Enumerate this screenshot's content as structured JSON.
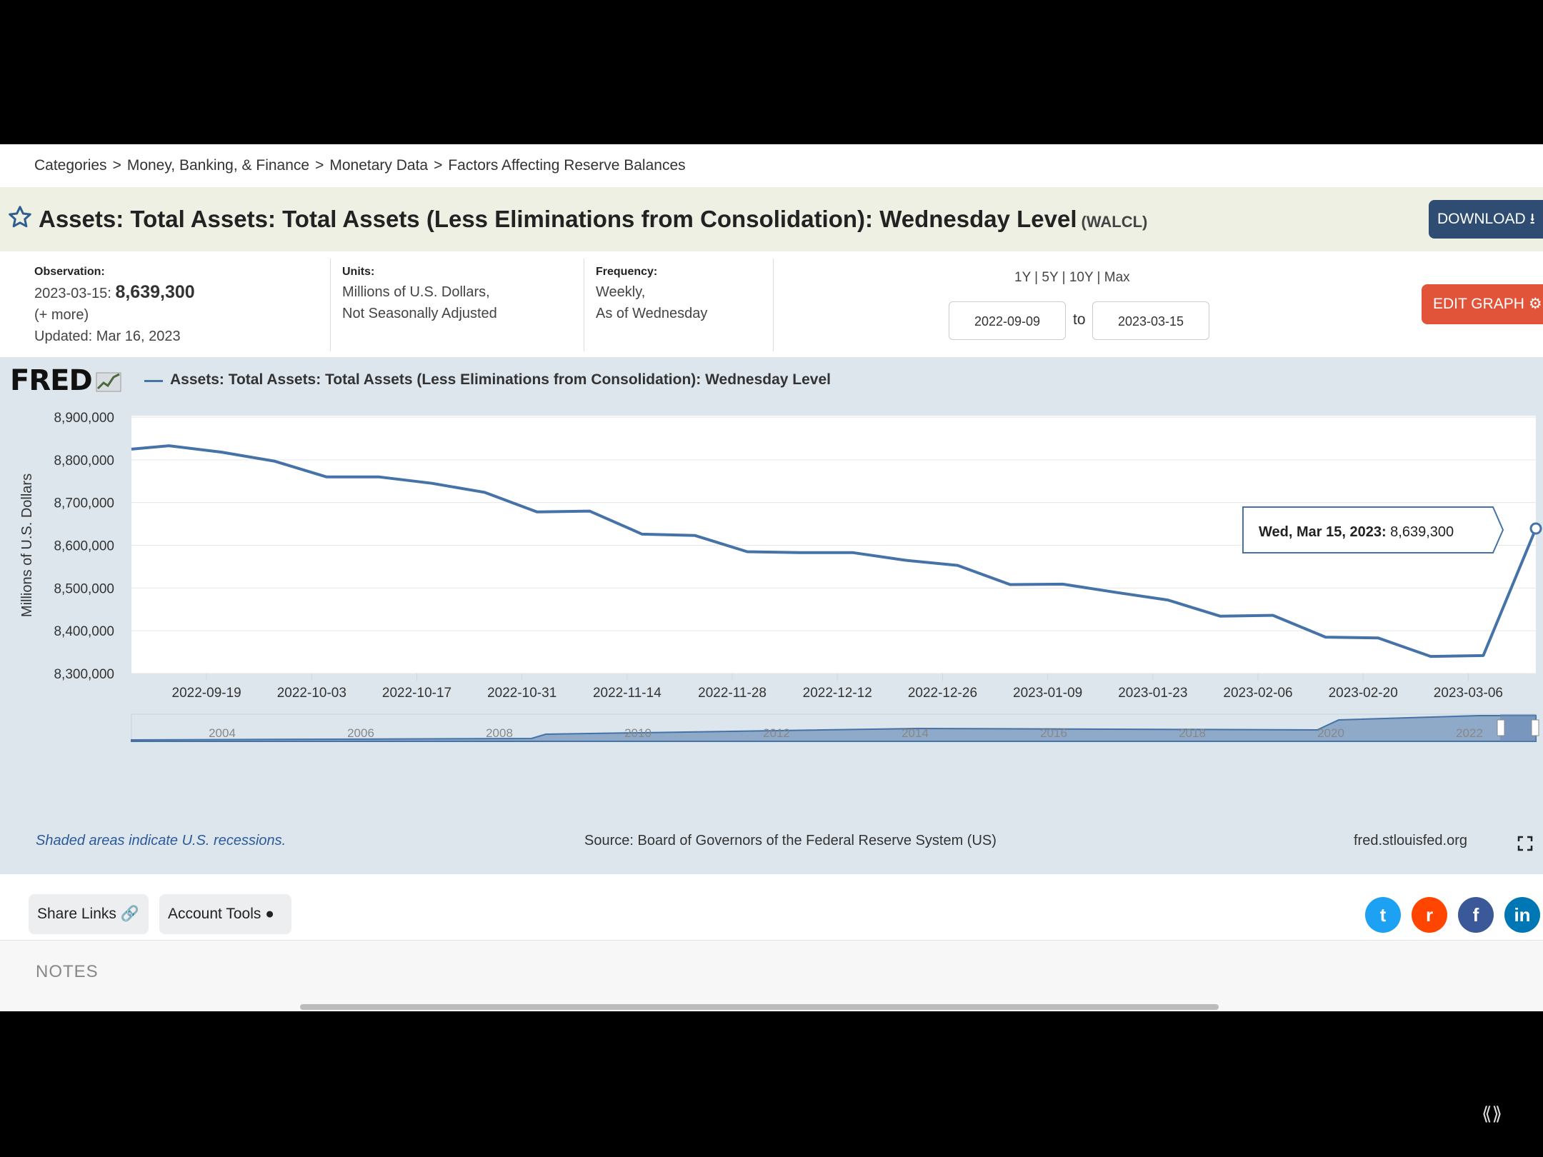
{
  "breadcrumb": [
    "Categories",
    "Money, Banking, & Finance",
    "Monetary Data",
    "Factors Affecting Reserve Balances"
  ],
  "header": {
    "title": "Assets: Total Assets: Total Assets (Less Eliminations from Consolidation): Wednesday Level",
    "code": "(WALCL)",
    "download_label": "DOWNLOAD"
  },
  "meta": {
    "observation_label": "Observation:",
    "observation_date": "2023-03-15:",
    "observation_value": "8,639,300",
    "more": "(+ more)",
    "updated": "Updated: Mar 16, 2023",
    "units_label": "Units:",
    "units_line1": "Millions of U.S. Dollars,",
    "units_line2": "Not Seasonally Adjusted",
    "frequency_label": "Frequency:",
    "frequency_line1": "Weekly,",
    "frequency_line2": "As of Wednesday",
    "ranges": [
      "1Y",
      "5Y",
      "10Y",
      "Max"
    ],
    "date_from": "2022-09-09",
    "to_label": "to",
    "date_to": "2023-03-15",
    "edit_label": "EDIT GRAPH"
  },
  "chart": {
    "logo": "FRED",
    "series_title": "Assets: Total Assets: Total Assets (Less Eliminations from Consolidation): Wednesday Level",
    "tooltip_date": "Wed, Mar 15, 2023:",
    "tooltip_value": "8,639,300",
    "navigator_years": [
      "2004",
      "2006",
      "2008",
      "2010",
      "2012",
      "2014",
      "2016",
      "2018",
      "2020",
      "2022"
    ],
    "recession_note": "Shaded areas indicate U.S. recessions.",
    "source": "Source: Board of Governors of the Federal Reserve System (US)",
    "site": "fred.stlouisfed.org"
  },
  "chart_data": {
    "type": "line",
    "title": "Assets: Total Assets: Total Assets (Less Eliminations from Consolidation): Wednesday Level",
    "ylabel": "Millions of U.S. Dollars",
    "xlabel": "",
    "ylim": [
      8300000,
      8900000
    ],
    "yticks": [
      "8,900,000",
      "8,800,000",
      "8,700,000",
      "8,600,000",
      "8,500,000",
      "8,400,000",
      "8,300,000"
    ],
    "ytick_values": [
      8900000,
      8800000,
      8700000,
      8600000,
      8500000,
      8400000,
      8300000
    ],
    "xlim": [
      "2022-09-09",
      "2023-03-15"
    ],
    "xticks": [
      "2022-09-19",
      "2022-10-03",
      "2022-10-17",
      "2022-10-31",
      "2022-11-14",
      "2022-11-28",
      "2022-12-12",
      "2022-12-26",
      "2023-01-09",
      "2023-01-23",
      "2023-02-06",
      "2023-02-20",
      "2023-03-06"
    ],
    "grid": true,
    "color": "#4572a7",
    "series": [
      {
        "x": [
          "2022-09-09",
          "2022-09-14",
          "2022-09-21",
          "2022-09-28",
          "2022-10-05",
          "2022-10-12",
          "2022-10-19",
          "2022-10-26",
          "2022-11-02",
          "2022-11-09",
          "2022-11-16",
          "2022-11-23",
          "2022-11-30",
          "2022-12-07",
          "2022-12-14",
          "2022-12-21",
          "2022-12-28",
          "2023-01-04",
          "2023-01-11",
          "2023-01-18",
          "2023-01-25",
          "2023-02-01",
          "2023-02-08",
          "2023-02-15",
          "2023-02-22",
          "2023-03-01",
          "2023-03-08",
          "2023-03-15"
        ],
        "values": [
          8825000,
          8833000,
          8818000,
          8797000,
          8760000,
          8760000,
          8745000,
          8724000,
          8678000,
          8680000,
          8626000,
          8623000,
          8585000,
          8583000,
          8583000,
          8565000,
          8553000,
          8508000,
          8509000,
          8490000,
          8472000,
          8434000,
          8436000,
          8385000,
          8383000,
          8340000,
          8342000,
          8639300
        ]
      }
    ]
  }
}
